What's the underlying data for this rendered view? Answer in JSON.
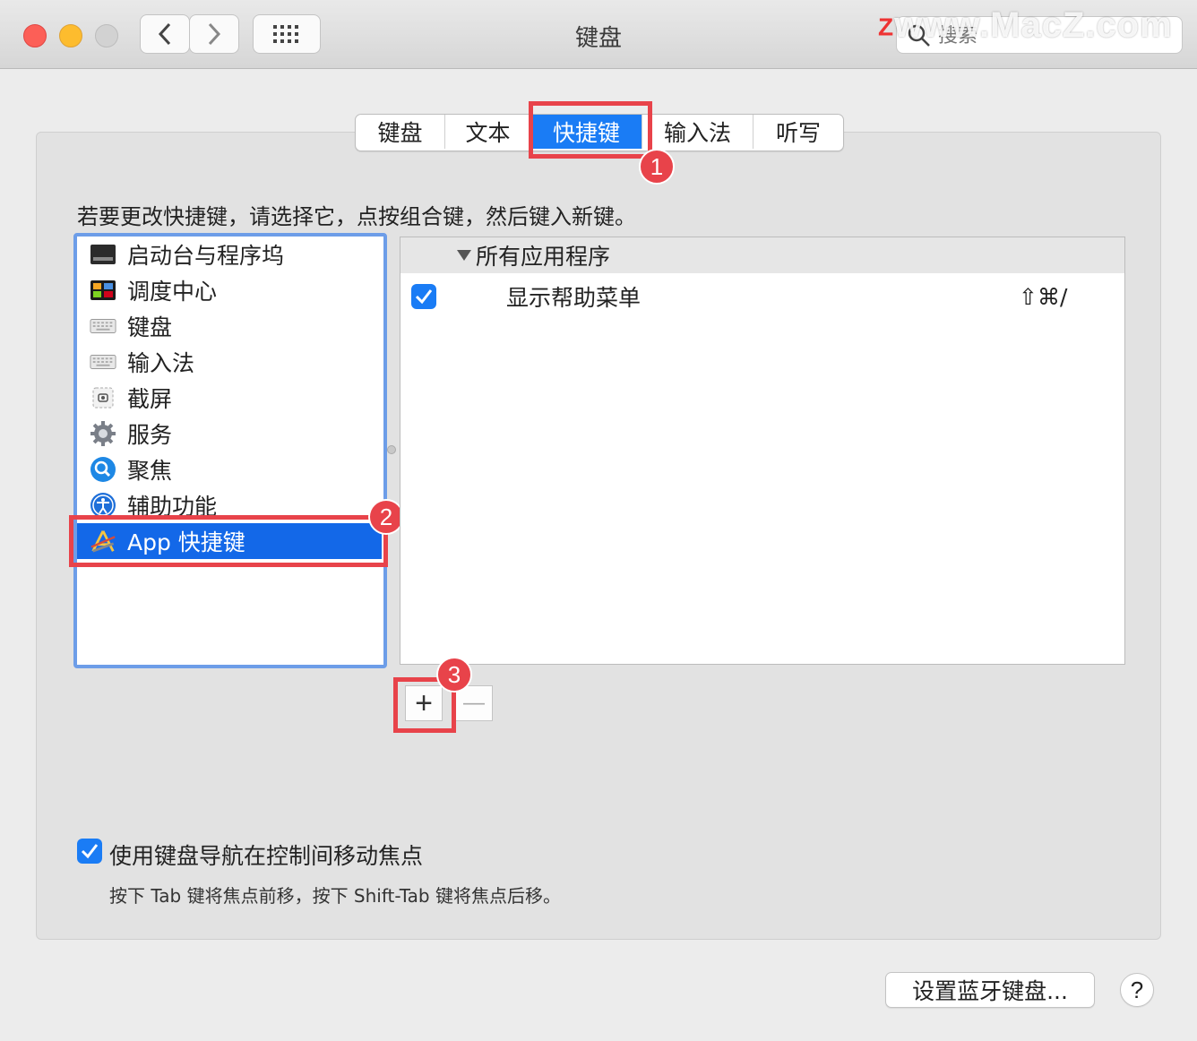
{
  "window": {
    "title": "键盘",
    "search_placeholder": "搜索",
    "watermark": "www.MacZ.com",
    "watermark_logo": "Z"
  },
  "tabs": [
    {
      "label": "键盘",
      "active": false
    },
    {
      "label": "文本",
      "active": false
    },
    {
      "label": "快捷键",
      "active": true
    },
    {
      "label": "输入法",
      "active": false
    },
    {
      "label": "听写",
      "active": false
    }
  ],
  "annotations": {
    "badge1": "1",
    "badge2": "2",
    "badge3": "3",
    "color": "#e8434a"
  },
  "instruction": "若要更改快捷键，请选择它，点按组合键，然后键入新键。",
  "categories": [
    {
      "label": "启动台与程序坞",
      "icon": "launchpad-dock-icon",
      "selected": false
    },
    {
      "label": "调度中心",
      "icon": "mission-control-icon",
      "selected": false
    },
    {
      "label": "键盘",
      "icon": "keyboard-icon",
      "selected": false
    },
    {
      "label": "输入法",
      "icon": "keyboard-icon",
      "selected": false
    },
    {
      "label": "截屏",
      "icon": "screenshot-icon",
      "selected": false
    },
    {
      "label": "服务",
      "icon": "gear-icon",
      "selected": false
    },
    {
      "label": "聚焦",
      "icon": "spotlight-icon",
      "selected": false
    },
    {
      "label": "辅助功能",
      "icon": "accessibility-icon",
      "selected": false
    },
    {
      "label": "App 快捷键",
      "icon": "app-store-icon",
      "selected": true
    }
  ],
  "shortcuts": {
    "group_label": "所有应用程序",
    "rows": [
      {
        "checked": true,
        "label": "显示帮助菜单",
        "keys": "⇧⌘/"
      }
    ]
  },
  "buttons": {
    "add": "+",
    "remove": "—",
    "bluetooth": "设置蓝牙键盘...",
    "help": "?"
  },
  "keyboard_nav": {
    "checked": true,
    "label": "使用键盘导航在控制间移动焦点",
    "hint": "按下 Tab 键将焦点前移，按下 Shift-Tab 键将焦点后移。"
  },
  "colors": {
    "accent": "#1a7cf5",
    "selection": "#1368e8"
  }
}
